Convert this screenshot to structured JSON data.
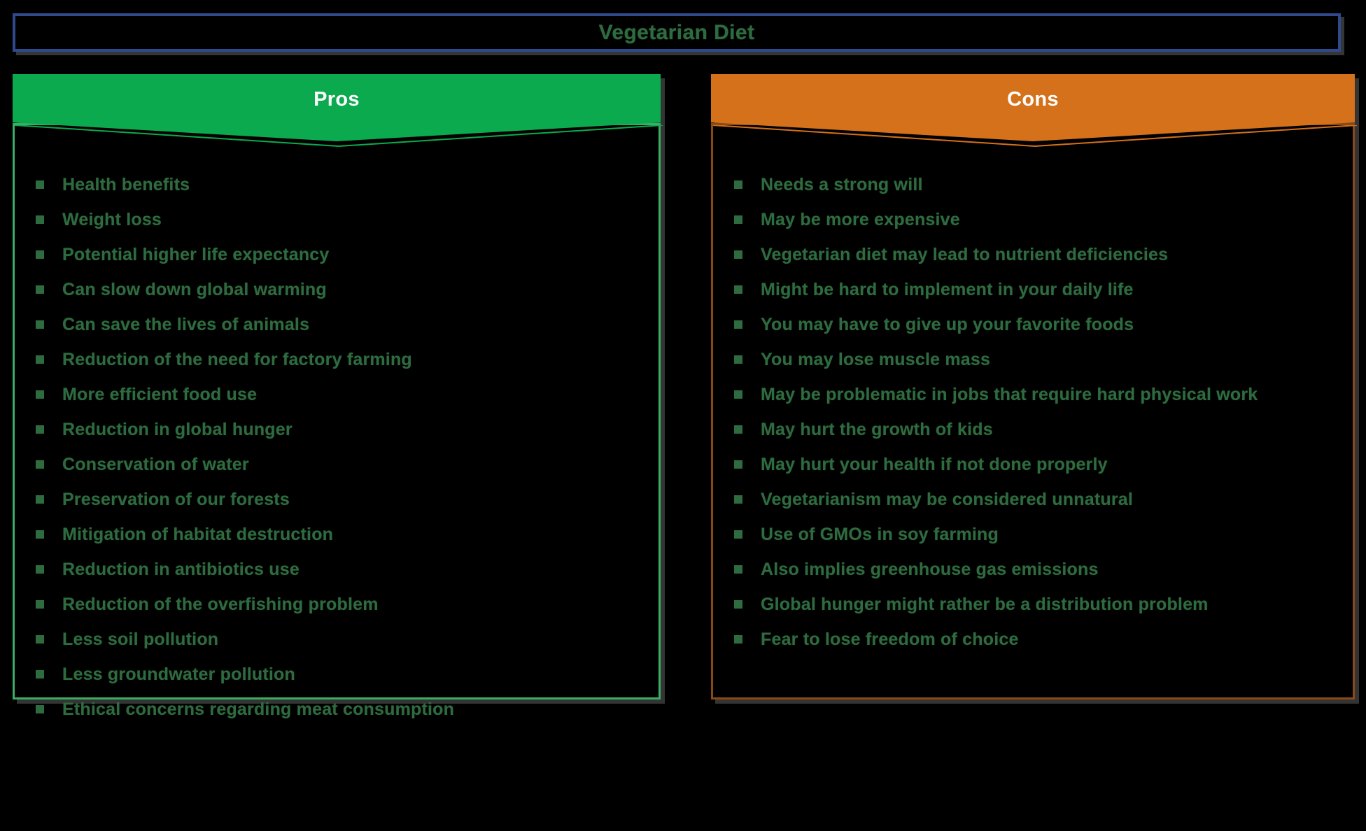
{
  "title": {
    "text": "Vegetarian Diet",
    "border_color": "#2E4A8C",
    "text_color": "#2E6B3F"
  },
  "background_color": "#000000",
  "panels": {
    "pros": {
      "header": "Pros",
      "header_bg": "#0CAA4E",
      "header_text_color": "#FFFFFF",
      "border_color": "#3BAE63",
      "bullet_color": "#2E6B3F",
      "items": [
        "Health benefits",
        "Weight loss",
        "Potential higher life expectancy",
        "Can slow down global warming",
        "Can save the lives of animals",
        "Reduction of the need for factory farming",
        "More efficient food use",
        "Reduction in global hunger",
        "Conservation of water",
        "Preservation of our forests",
        "Mitigation of habitat destruction",
        "Reduction in antibiotics use",
        "Reduction of the overfishing problem",
        "Less soil pollution",
        "Less groundwater pollution",
        "Ethical concerns regarding meat consumption"
      ]
    },
    "cons": {
      "header": "Cons",
      "header_bg": "#D4711A",
      "header_text_color": "#FFFFFF",
      "border_color": "#8A4A18",
      "bullet_color": "#2E6B3F",
      "items": [
        "Needs a strong will",
        "May be more expensive",
        "Vegetarian diet may lead to nutrient deficiencies",
        "Might be hard to implement in your daily life",
        "You may have to give up your favorite foods",
        "You may lose muscle mass",
        "May be problematic in jobs that require hard physical work",
        "May hurt the growth of kids",
        "May hurt your health if not done properly",
        "Vegetarianism may be considered unnatural",
        "Use of GMOs in soy farming",
        "Also implies greenhouse gas emissions",
        "Global hunger might rather be a distribution problem",
        "Fear to lose freedom of choice"
      ]
    }
  }
}
